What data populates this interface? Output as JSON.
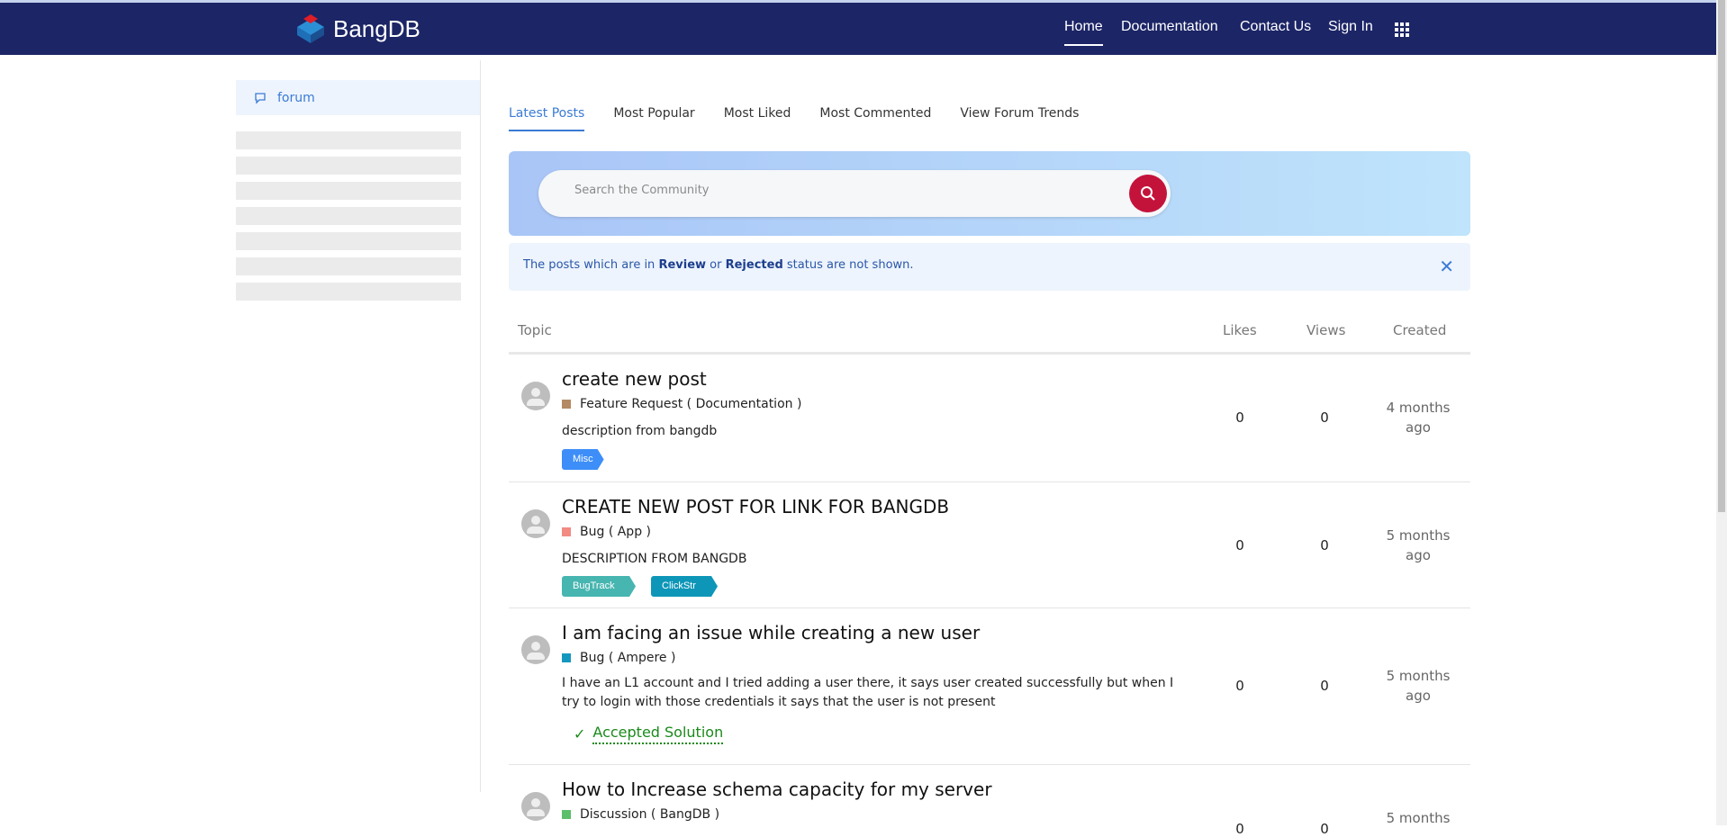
{
  "header": {
    "brand": "BangDB",
    "nav": [
      "Home",
      "Documentation",
      "Contact Us",
      "Sign In"
    ]
  },
  "sidebar": {
    "forum_label": "forum"
  },
  "tabs": [
    "Latest Posts",
    "Most Popular",
    "Most Liked",
    "Most Commented",
    "View Forum Trends"
  ],
  "search": {
    "placeholder": "Search the Community"
  },
  "notice": {
    "pre": "The posts which are in ",
    "review": "Review",
    "mid": " or ",
    "rejected": "Rejected",
    "post": " status are not shown."
  },
  "table": {
    "headers": [
      "Topic",
      "Likes",
      "Views",
      "Created"
    ]
  },
  "posts": [
    {
      "title": "create new post",
      "category": "Feature Request ( Documentation )",
      "category_color": "#b38a63",
      "description": "description from bangdb",
      "tags": [
        {
          "label": "Misc",
          "color": "#3d8ef8"
        }
      ],
      "likes": "0",
      "views": "0",
      "created": "4 months ago"
    },
    {
      "title": "CREATE NEW POST FOR LINK FOR BANGDB",
      "category": "Bug ( App )",
      "category_color": "#f28b82",
      "description": "DESCRIPTION FROM BANGDB",
      "tags": [
        {
          "label": "BugTrack ...",
          "color": "#47b5b0"
        },
        {
          "label": "ClickStr ...",
          "color": "#0d96b8"
        }
      ],
      "likes": "0",
      "views": "0",
      "created": "5 months ago"
    },
    {
      "title": "I am facing an issue while creating a new user",
      "category": "Bug ( Ampere )",
      "category_color": "#1497bf",
      "description": "I have an L1 account and I tried adding a user there, it says user created successfully but when I try to login with those credentials it says that the user is not present",
      "accepted": "Accepted Solution",
      "likes": "0",
      "views": "0",
      "created": "5 months ago"
    },
    {
      "title": "How to Increase schema capacity for my server",
      "category": "Discussion ( BangDB )",
      "category_color": "#5cbf6a",
      "likes": "0",
      "views": "0",
      "created": "5 months"
    }
  ]
}
